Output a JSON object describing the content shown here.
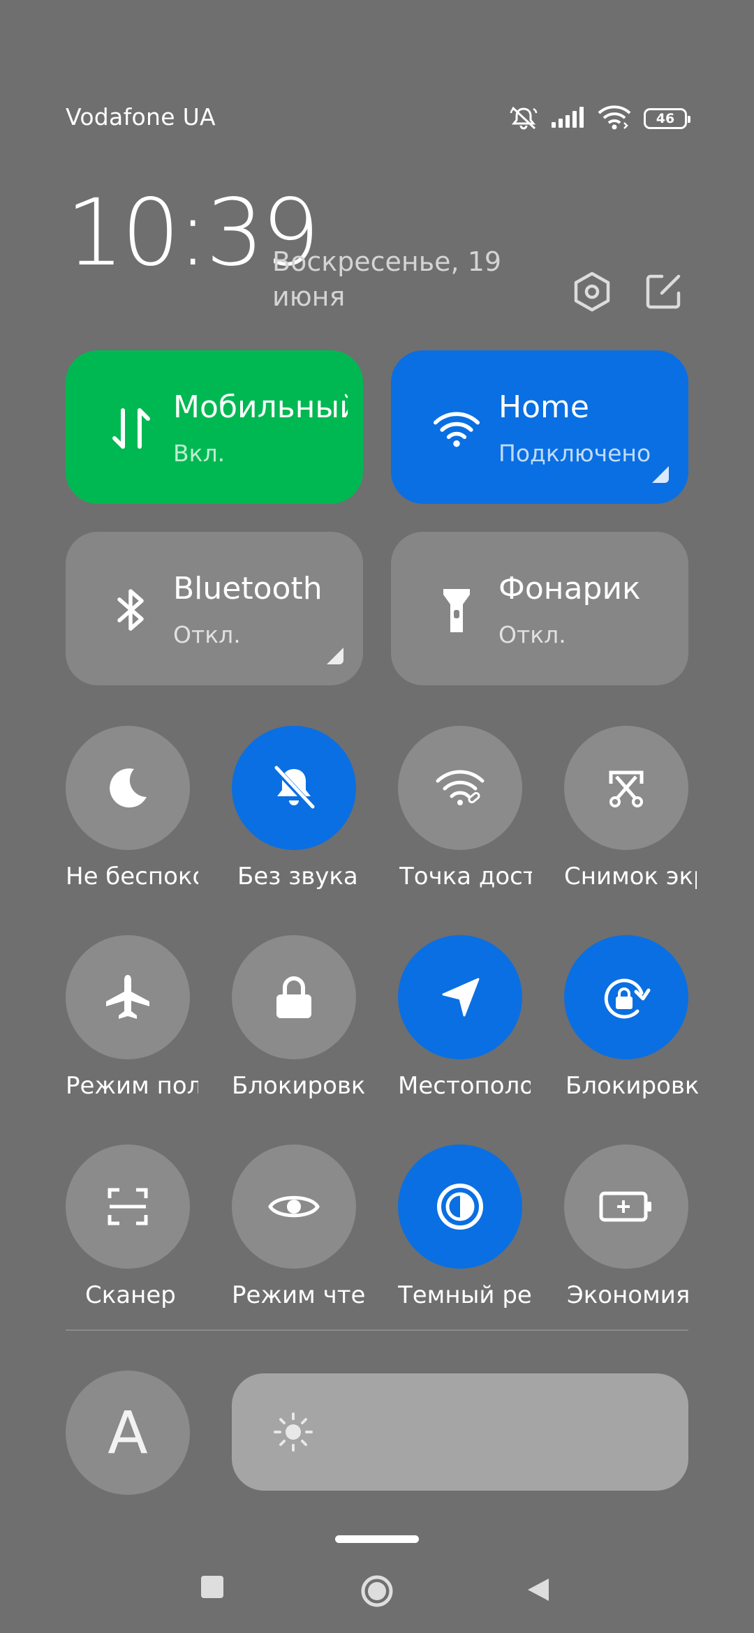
{
  "status_bar": {
    "carrier": "Vodafone UA",
    "battery_level": "46",
    "icons": [
      "silent-bell-icon",
      "signal-icon",
      "wifi-icon",
      "battery-icon"
    ]
  },
  "header": {
    "time": "10:39",
    "date": "Воскресенье, 19 июня",
    "icons": [
      "settings-hex-icon",
      "edit-icon"
    ]
  },
  "big_tiles": [
    {
      "title": "Мобильный",
      "subtitle": "Вкл.",
      "icon": "mobile-data-icon",
      "color": "#00b852",
      "state": "on"
    },
    {
      "title": "Home",
      "subtitle": "Подключено",
      "icon": "wifi-icon",
      "color": "#0a6fe2",
      "state": "on"
    },
    {
      "title": "Bluetooth",
      "subtitle": "Откл.",
      "icon": "bluetooth-icon",
      "color": "#868686",
      "state": "off"
    },
    {
      "title": "Фонарик",
      "subtitle": "Откл.",
      "icon": "flashlight-icon",
      "color": "#868686",
      "state": "off"
    }
  ],
  "toggles": [
    {
      "label": "Не беспокоить",
      "icon": "moon-icon",
      "active": false
    },
    {
      "label": "Без звука",
      "icon": "bell-off-icon",
      "active": true
    },
    {
      "label": "Точка доступа",
      "icon": "hotspot-icon",
      "active": false
    },
    {
      "label": "Снимок экрана",
      "icon": "screenshot-icon",
      "active": false
    },
    {
      "label": "Режим полета",
      "icon": "airplane-icon",
      "active": false
    },
    {
      "label": "Блокировка",
      "icon": "lock-icon",
      "active": false
    },
    {
      "label": "Местоположение",
      "icon": "location-icon",
      "active": true
    },
    {
      "label": "Блокировка",
      "icon": "rotation-lock-icon",
      "active": true
    },
    {
      "label": "Сканер",
      "icon": "scanner-icon",
      "active": false
    },
    {
      "label": "Режим чтения",
      "icon": "eye-icon",
      "active": false
    },
    {
      "label": "Темный режим",
      "icon": "dark-mode-icon",
      "active": true
    },
    {
      "label": "Экономия",
      "icon": "battery-saver-icon",
      "active": false
    }
  ],
  "bottom": {
    "font_button": "A",
    "brightness_icon": "sun-icon"
  },
  "colors": {
    "accent_blue": "#0a6fe2",
    "accent_green": "#00b852",
    "background": "#6f6f6f"
  }
}
